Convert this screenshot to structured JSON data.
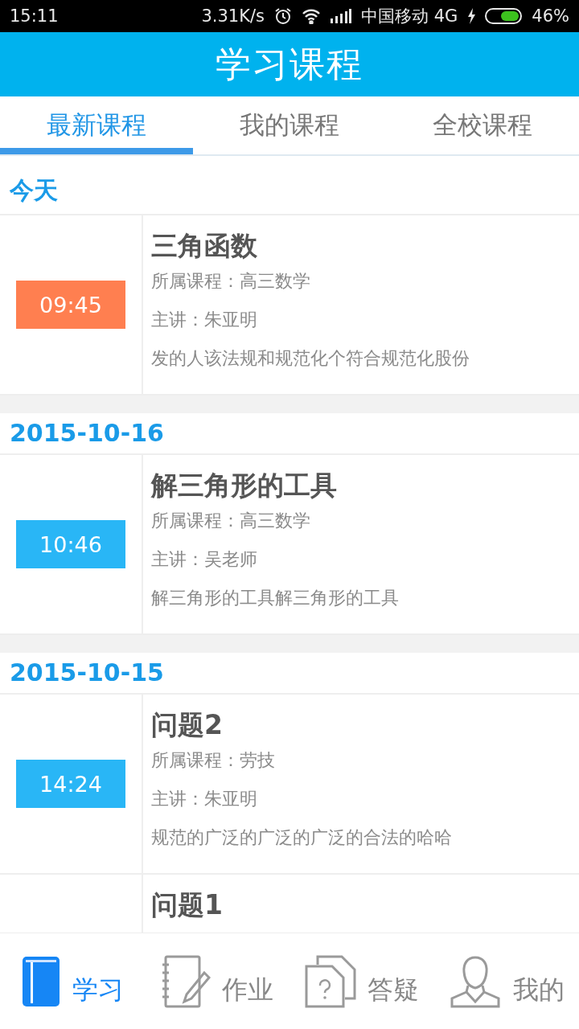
{
  "status_bar": {
    "time": "15:11",
    "speed": "3.31K/s",
    "carrier": "中国移动 4G",
    "battery": "46%"
  },
  "header": {
    "title": "学习课程"
  },
  "tabs": [
    {
      "label": "最新课程",
      "selected": true
    },
    {
      "label": "我的课程",
      "selected": false
    },
    {
      "label": "全校课程",
      "selected": false
    }
  ],
  "groups": [
    {
      "date": "今天",
      "lessons": [
        {
          "time": "09:45",
          "color": "#ff7f50",
          "title": "三角函数",
          "course": "所属课程：高三数学",
          "teacher": "主讲：朱亚明",
          "summary": "发的人该法规和规范化个符合规范化股份"
        }
      ]
    },
    {
      "date": "2015-10-16",
      "lessons": [
        {
          "time": "10:46",
          "color": "#29b6f6",
          "title": "解三角形的工具",
          "course": "所属课程：高三数学",
          "teacher": "主讲：吴老师",
          "summary": "解三角形的工具解三角形的工具"
        }
      ]
    },
    {
      "date": "2015-10-15",
      "lessons": [
        {
          "time": "14:24",
          "color": "#29b6f6",
          "title": "问题2",
          "course": "所属课程：劳技",
          "teacher": "主讲：朱亚明",
          "summary": "规范的广泛的广泛的广泛的合法的哈哈"
        },
        {
          "title": "问题1"
        }
      ]
    }
  ],
  "nav": [
    {
      "kind": "book",
      "label": "学习",
      "selected": true
    },
    {
      "kind": "notebook",
      "label": "作业",
      "selected": false
    },
    {
      "kind": "question",
      "label": "答疑",
      "selected": false
    },
    {
      "kind": "person",
      "label": "我的",
      "selected": false
    }
  ]
}
